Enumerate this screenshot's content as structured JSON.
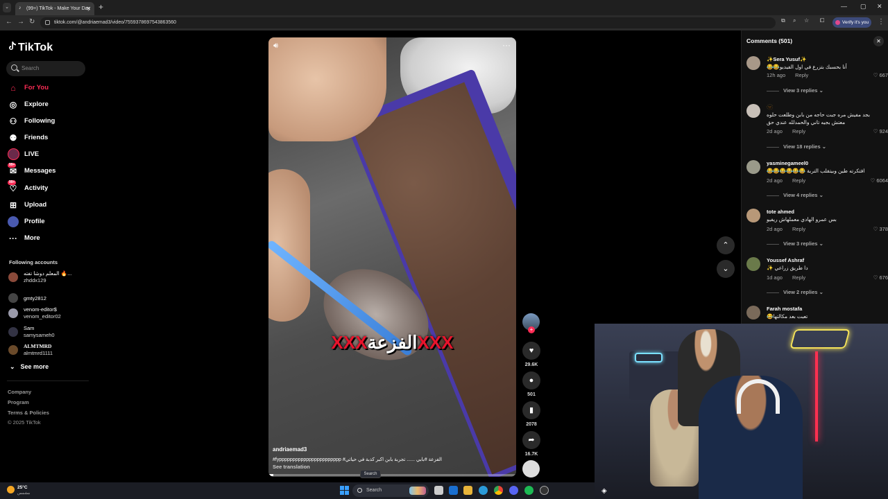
{
  "browser": {
    "tab_title": "(99+) TikTok - Make Your Day",
    "tab_favicon": "tiktok-icon",
    "url": "tiktok.com/@andriaemad3/video/7559378697543863560",
    "verify_label": "Verify it's you"
  },
  "sidebar": {
    "logo": "TikTok",
    "search_placeholder": "Search",
    "nav": [
      {
        "label": "For You",
        "icon": "home-icon",
        "active": true
      },
      {
        "label": "Explore",
        "icon": "compass-icon"
      },
      {
        "label": "Following",
        "icon": "following-icon"
      },
      {
        "label": "Friends",
        "icon": "friends-icon"
      },
      {
        "label": "LIVE",
        "icon": "live-icon"
      },
      {
        "label": "Messages",
        "icon": "messages-icon",
        "badge": "99+"
      },
      {
        "label": "Activity",
        "icon": "activity-icon",
        "badge": "99+"
      },
      {
        "label": "Upload",
        "icon": "upload-icon"
      },
      {
        "label": "Profile",
        "icon": "profile-icon"
      },
      {
        "label": "More",
        "icon": "more-icon"
      }
    ],
    "following_title": "Following accounts",
    "accounts": [
      {
        "name": "المعلم دوشا تفته 🔥...",
        "handle": "zhddx129"
      },
      {
        "name": "gmty2812",
        "handle": ""
      },
      {
        "name": "venom-editor$",
        "handle": "venom_editor02"
      },
      {
        "name": "Sam",
        "handle": "samysameh0"
      },
      {
        "name": "ALMTMRD",
        "handle": "almtmrd1111"
      }
    ],
    "see_more": "See more",
    "footer": [
      "Company",
      "Program",
      "Terms & Policies",
      "© 2025 TikTok"
    ]
  },
  "video": {
    "caption_overlay": "الفزعة",
    "caption_x": "XXX",
    "author": "andriaemad3",
    "description": "#fyppppppppppppppppppppppp #الفزعة #بابي ...... تجربة بابن اكبر كذبة في حياتي",
    "see_translation": "See translation",
    "progress": 0.02,
    "actions": {
      "likes": "29.6K",
      "comments": "501",
      "saves": "2078",
      "shares": "16.7K"
    }
  },
  "comments": {
    "title": "Comments (501)",
    "items": [
      {
        "user": "✨Sera Yusuf✨",
        "text": "😂😂أنا بحسبك بتزرع في اول الفيديو",
        "time": "12h ago",
        "reply": "Reply",
        "likes": "667",
        "view_replies": "View 3 replies"
      },
      {
        "user": "🫥",
        "text": "بجد مفيش مره جبت حاجه من بابن وطلعت حلوه",
        "text2": "معتش بجيه تاني والحمدلله عندي حق",
        "time": "2d ago",
        "reply": "Reply",
        "likes": "924",
        "view_replies": "View 18 replies"
      },
      {
        "user": "yasminegameel0",
        "text": "😂😂😂😂😂😂 افتكرته طين وبيتقلب التربة",
        "time": "2d ago",
        "reply": "Reply",
        "likes": "6064",
        "view_replies": "View 4 replies"
      },
      {
        "user": "tote ahmed",
        "text": "بس عمرو الهادي معملهاش ريفيو",
        "time": "2d ago",
        "reply": "Reply",
        "likes": "378",
        "view_replies": "View 3 replies"
      },
      {
        "user": "Youssef Ashraf",
        "text": "✨ دا طريق زراعي",
        "time": "1d ago",
        "reply": "Reply",
        "likes": "676",
        "view_replies": "View 2 replies"
      },
      {
        "user": "Farah mostafa",
        "text": "😂تعبت بعد مكالتها",
        "time": "",
        "reply": "",
        "likes": "",
        "view_replies": ""
      }
    ]
  },
  "taskbar": {
    "temp": "25°C",
    "weather_text": "مشمس",
    "search_placeholder": "Search",
    "tooltip": "Search"
  }
}
